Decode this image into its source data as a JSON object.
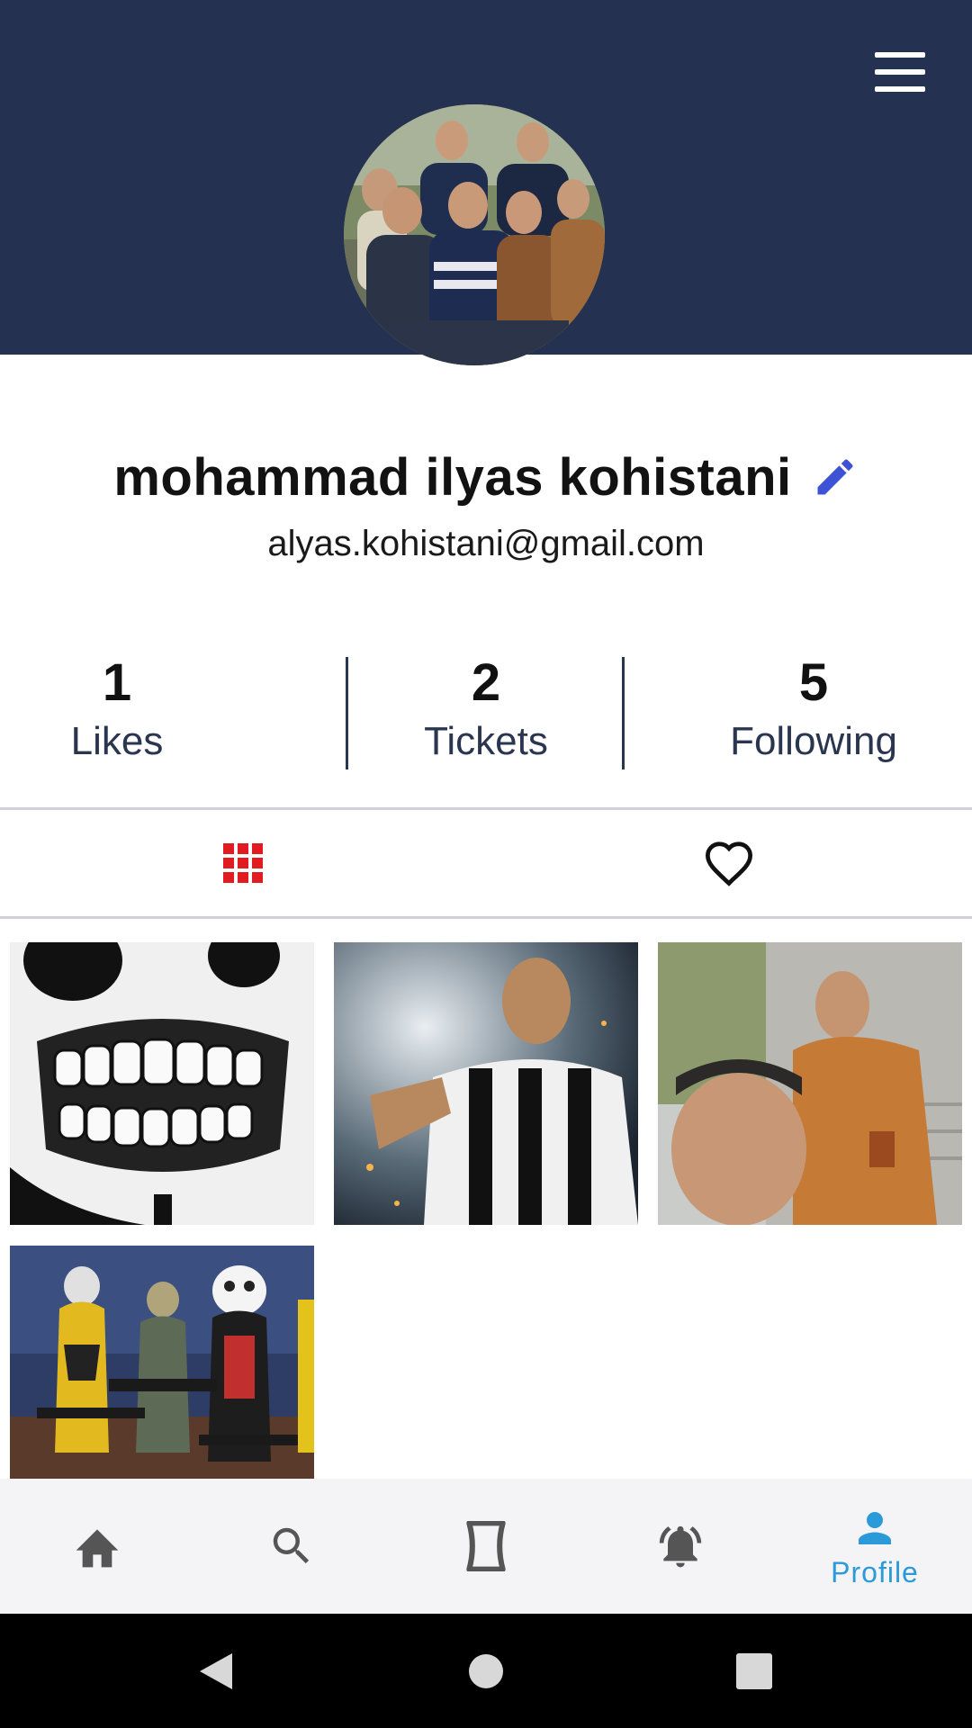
{
  "header": {
    "background_color": "#243150",
    "menu_icon": "hamburger-menu-icon",
    "avatar_alt": "profile photo"
  },
  "profile": {
    "name": "mohammad ilyas kohistani",
    "email": "alyas.kohistani@gmail.com",
    "edit_icon": "pencil-icon",
    "accent_color": "#3d52d5"
  },
  "stats": [
    {
      "value": "1",
      "label": "Likes"
    },
    {
      "value": "2",
      "label": "Tickets"
    },
    {
      "value": "5",
      "label": "Following"
    }
  ],
  "tabs": [
    {
      "icon": "grid-icon",
      "active": true,
      "active_color": "#e11b22"
    },
    {
      "icon": "heart-outline-icon",
      "active": false
    }
  ],
  "posts": [
    {
      "subject": "skull-teeth-artwork"
    },
    {
      "subject": "footballer-celebration"
    },
    {
      "subject": "selfie-orange-hoodie"
    },
    {
      "subject": "game-characters-lobby"
    }
  ],
  "bottom_nav": {
    "items": [
      {
        "icon": "home-icon",
        "label": "",
        "active": false
      },
      {
        "icon": "search-icon",
        "label": "",
        "active": false
      },
      {
        "icon": "ticket-icon",
        "label": "",
        "active": false
      },
      {
        "icon": "bell-icon",
        "label": "",
        "active": false
      },
      {
        "icon": "person-icon",
        "label": "Profile",
        "active": true
      }
    ],
    "active_color": "#2b9ad8",
    "inactive_color": "#555555"
  },
  "system_nav": [
    "back-icon",
    "home-circle-icon",
    "recents-icon"
  ]
}
